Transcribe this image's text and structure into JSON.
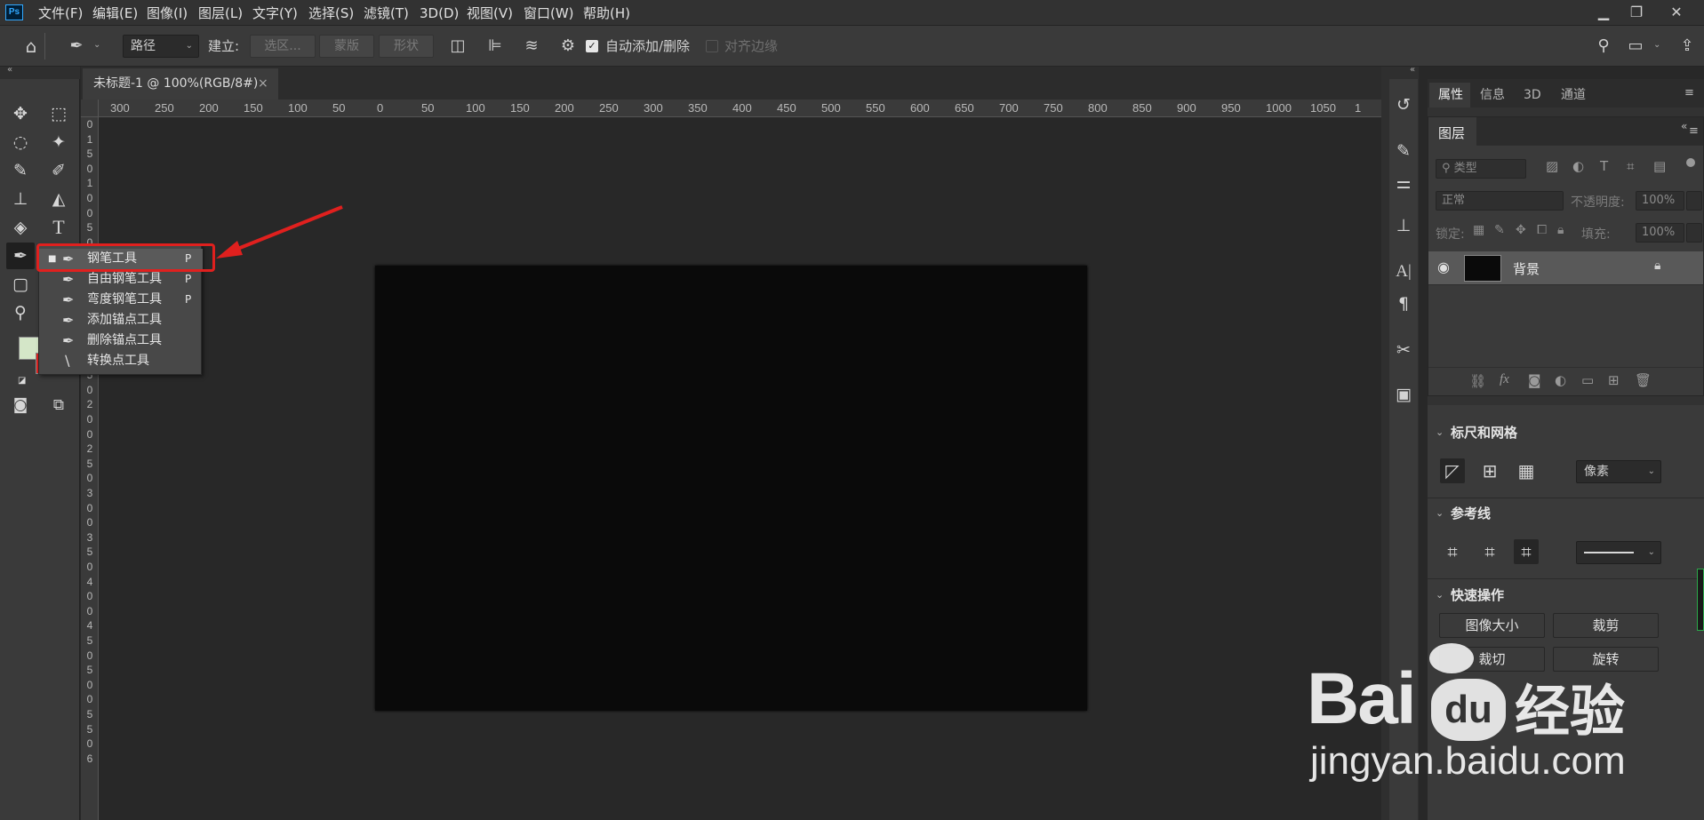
{
  "app": {
    "logo": "Ps"
  },
  "menu": [
    "文件(F)",
    "编辑(E)",
    "图像(I)",
    "图层(L)",
    "文字(Y)",
    "选择(S)",
    "滤镜(T)",
    "3D(D)",
    "视图(V)",
    "窗口(W)",
    "帮助(H)"
  ],
  "window_controls": [
    "minimize-icon",
    "restore-icon",
    "close-icon"
  ],
  "options": {
    "mode_value": "路径",
    "make_label": "建立:",
    "selection_btn": "选区...",
    "mask_btn": "蒙版",
    "shape_btn": "形状",
    "auto_add_label": "自动添加/删除",
    "auto_add_checked": true,
    "align_edges_label": "对齐边缘",
    "align_edges_checked": false
  },
  "document": {
    "tab_title": "未标题-1 @ 100%(RGB/8#)",
    "close": "×",
    "canvas_color": "#0a0a0a"
  },
  "ruler_top": [
    "300",
    "250",
    "200",
    "150",
    "100",
    "50",
    "0",
    "50",
    "100",
    "150",
    "200",
    "250",
    "300",
    "350",
    "400",
    "450",
    "500",
    "550",
    "600",
    "650",
    "700",
    "750",
    "800",
    "850",
    "900",
    "950",
    "1000",
    "1050",
    "1"
  ],
  "ruler_left": [
    "0",
    "1",
    "5",
    "0",
    "1",
    "0",
    "0",
    "5",
    "0",
    "0",
    "5",
    "0",
    "0",
    "1",
    "0",
    "0",
    "1",
    "5",
    "0",
    "2",
    "0",
    "0",
    "2",
    "5",
    "0",
    "3",
    "0",
    "0",
    "3",
    "5",
    "0",
    "4",
    "0",
    "0",
    "4",
    "5",
    "0",
    "5",
    "0",
    "0",
    "5",
    "5",
    "0",
    "6"
  ],
  "flyout": {
    "items": [
      {
        "label": "钢笔工具",
        "shortcut": "P",
        "icon": "pen-icon",
        "selected": true
      },
      {
        "label": "自由钢笔工具",
        "shortcut": "P",
        "icon": "freeform-pen-icon"
      },
      {
        "label": "弯度钢笔工具",
        "shortcut": "P",
        "icon": "curvature-pen-icon"
      },
      {
        "label": "添加锚点工具",
        "shortcut": "",
        "icon": "add-anchor-icon"
      },
      {
        "label": "删除锚点工具",
        "shortcut": "",
        "icon": "delete-anchor-icon"
      },
      {
        "label": "转换点工具",
        "shortcut": "",
        "icon": "convert-point-icon"
      }
    ]
  },
  "colors": {
    "foreground": "#d4e6c8",
    "background": "#e0201e",
    "highlight": "#e0201e"
  },
  "panel_tabs": [
    "属性",
    "信息",
    "3D",
    "通道"
  ],
  "layers": {
    "title": "图层",
    "filter_placeholder": "类型",
    "blend_mode": "正常",
    "opacity_label": "不透明度:",
    "opacity_value": "100%",
    "lock_label": "锁定:",
    "fill_label": "填充:",
    "fill_value": "100%",
    "rows": [
      {
        "name": "背景",
        "locked": true
      }
    ]
  },
  "ruler_grid": {
    "title": "标尺和网格",
    "units": "像素"
  },
  "guides": {
    "title": "参考线"
  },
  "quick_actions": {
    "title": "快速操作",
    "buttons": [
      "图像大小",
      "裁剪",
      "裁切",
      "旋转"
    ]
  },
  "watermark": {
    "brand_left": "Bai",
    "brand_paw": "du",
    "brand_cn": "经验",
    "url": "jingyan.baidu.com"
  }
}
